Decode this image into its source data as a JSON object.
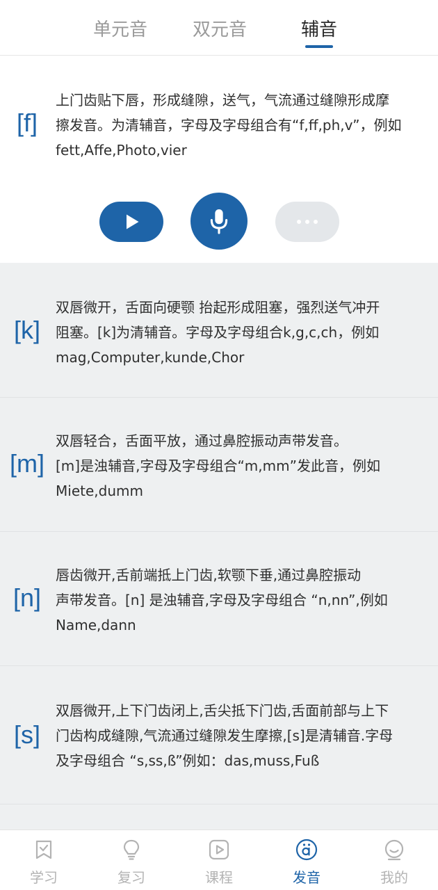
{
  "tabs": [
    {
      "label": "单元音"
    },
    {
      "label": "双元音"
    },
    {
      "label": "辅音",
      "active": true
    }
  ],
  "active_phoneme": {
    "symbol": "[f]",
    "lines": [
      "上门齿贴下唇，形成缝隙，送气，气流通过缝隙形成摩",
      "擦发音。为清辅音，字母及字母组合有“f,ff,ph,v”，例如",
      "fett,Affe,Photo,vier"
    ]
  },
  "controls": {
    "play_icon": "play-icon",
    "mic_icon": "microphone-icon",
    "more_icon": "more-dots-icon"
  },
  "phonemes": [
    {
      "symbol": "[k]",
      "lines": [
        "双唇微开，舌面向硬颚 抬起形成阻塞，强烈送气冲开",
        "阻塞。[k]为清辅音。字母及字母组合k,g,c,ch，例如",
        "mag,Computer,kunde,Chor"
      ]
    },
    {
      "symbol": "[m]",
      "lines": [
        "双唇轻合，舌面平放，通过鼻腔振动声带发音。",
        "[m]是浊辅音,字母及字母组合“m,mm”发此音，例如",
        "Miete,dumm"
      ]
    },
    {
      "symbol": "[n]",
      "lines": [
        "唇齿微开,舌前端抵上门齿,软颚下垂,通过鼻腔振动",
        "声带发音。[n] 是浊辅音,字母及字母组合 “n,nn”,例如",
        "Name,dann"
      ]
    },
    {
      "symbol": "[s]",
      "lines": [
        "双唇微开,上下门齿闭上,舌尖抵下门齿,舌面前部与上下",
        "门齿构成缝隙,气流通过缝隙发生摩擦,[s]是清辅音.字母",
        "及字母组合 “s,ss,ß”例如：das,muss,Fuß"
      ]
    }
  ],
  "bottom_nav": [
    {
      "label": "学习",
      "icon": "bookmark-icon"
    },
    {
      "label": "复习",
      "icon": "lightbulb-icon"
    },
    {
      "label": "课程",
      "icon": "video-play-icon"
    },
    {
      "label": "发音",
      "icon": "umlaut-a-icon",
      "active": true
    },
    {
      "label": "我的",
      "icon": "smiley-face-icon"
    }
  ],
  "colors": {
    "accent": "#1e64a8",
    "inactive": "#b3b3b3",
    "list_bg": "#eef0f1"
  }
}
